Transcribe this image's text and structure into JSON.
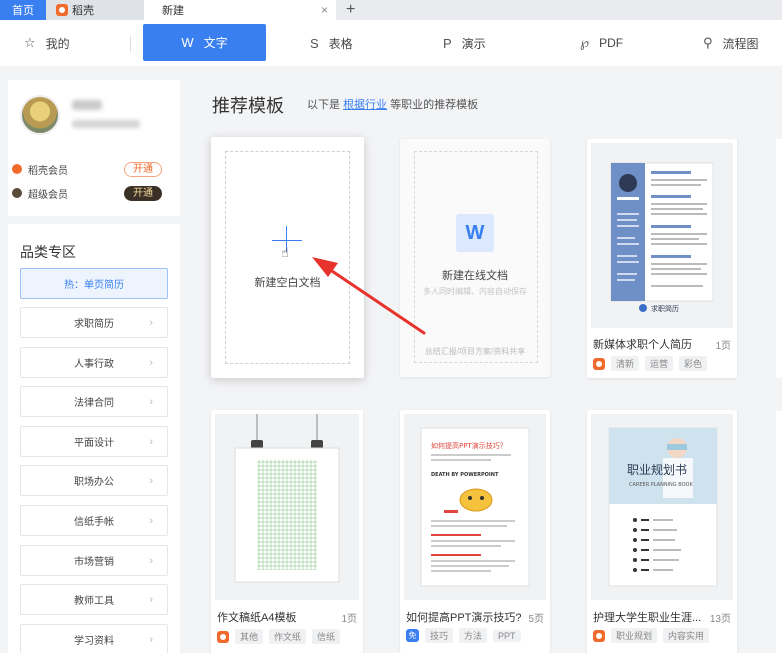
{
  "tabs": {
    "home": "首页",
    "doke": "稻壳",
    "active": "新建",
    "close": "×",
    "plus": "+"
  },
  "typebar": {
    "mine": "我的",
    "word": "文字",
    "table": "表格",
    "ppt": "演示",
    "pdf": "PDF",
    "flow": "流程图",
    "star_icon": "☆",
    "word_icon": "W",
    "table_icon": "S",
    "ppt_icon": "P",
    "pdf_icon": "℘",
    "flow_icon": "⚲"
  },
  "user": {
    "doke_member": "稻壳会员",
    "doke_btn": "开通",
    "super_member": "超级会员",
    "super_btn": "开通"
  },
  "categories": {
    "title": "品类专区",
    "hot": "热：单页简历",
    "items": [
      "求职简历",
      "人事行政",
      "法律合同",
      "平面设计",
      "职场办公",
      "信纸手帐",
      "市场营销",
      "教师工具",
      "学习资料"
    ],
    "chevron": "›"
  },
  "main": {
    "title": "推荐模板",
    "sub_prefix": "以下是",
    "sub_link": "根据行业",
    "sub_suffix": "等职业的推荐模板"
  },
  "blank_card": {
    "label": "新建空白文档"
  },
  "online_card": {
    "icon": "W",
    "label": "新建在线文档",
    "sub": "多人同时编辑、内容自动保存",
    "foot": "总结汇报/项目方案/资料共享"
  },
  "templates": [
    {
      "name": "新媒体求职个人简历",
      "pages": "1页",
      "tags": [
        "清新",
        "运营",
        "彩色"
      ],
      "brand": "doke"
    },
    {
      "name": "作文稿纸A4模板",
      "pages": "1页",
      "tags": [
        "其他",
        "作文纸",
        "信纸"
      ],
      "brand": "doke"
    },
    {
      "name": "如何提高PPT演示技巧?",
      "pages": "5页",
      "tags": [
        "技巧",
        "方法",
        "PPT"
      ],
      "brand": "free",
      "brand_label": "免"
    },
    {
      "name": "护理大学生职业生涯...",
      "pages": "13页",
      "tags": [
        "职业规划",
        "内容实用"
      ],
      "brand": "doke"
    }
  ],
  "thumbs": {
    "resume_footer": "求职简历",
    "ppt_title": "如何提高PPT演示技巧？",
    "ppt_sub": "DEATH BY POWERPOINT",
    "career_title": "职业规划书",
    "career_sub": "CAREER PLANNING BOOK"
  },
  "colors": {
    "accent": "#3a7ff0",
    "brand_orange": "#f06a2b",
    "arrow_red": "#e8322c"
  }
}
